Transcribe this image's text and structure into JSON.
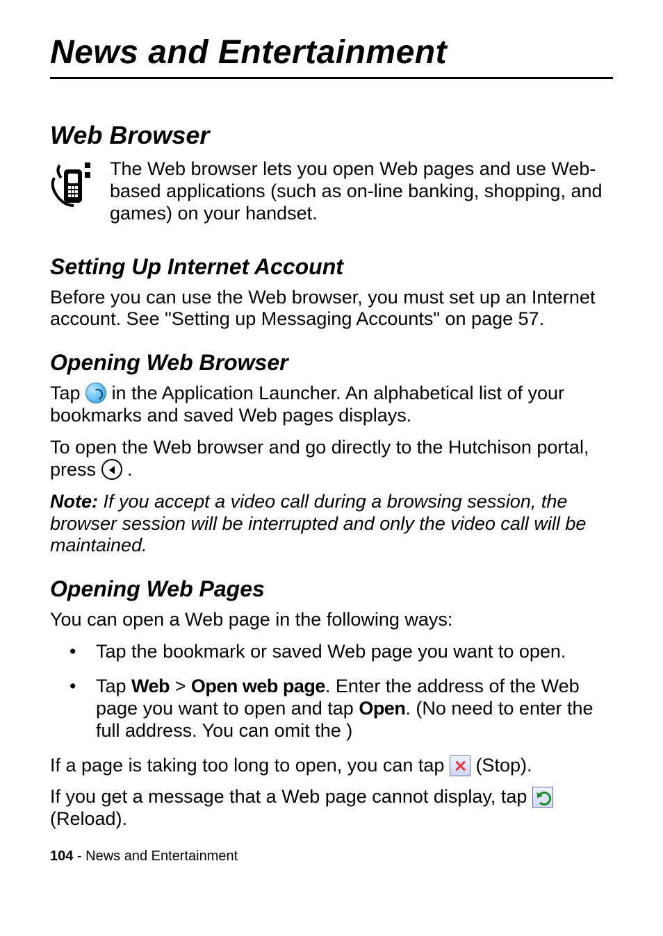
{
  "chapter_title": "News and Entertainment",
  "section_web_browser": {
    "heading": "Web Browser",
    "intro": "The Web browser lets you open Web pages and use Web-based applications (such as on-line banking, shopping, and games) on your handset."
  },
  "section_setup": {
    "heading": "Setting Up Internet Account",
    "body": "Before you can use the Web browser, you must set up an Internet account. See \"Setting up Messaging Accounts\" on page 57."
  },
  "section_open_browser": {
    "heading": "Opening Web Browser",
    "p1_pre": "Tap ",
    "p1_post": " in the Application Launcher. An alphabetical list of your bookmarks and saved Web pages displays.",
    "p2_pre": "To open the Web browser and go directly to the Hutchison portal, press ",
    "p2_post": ".",
    "note_label": "Note: ",
    "note_body": "If you accept a video call during a browsing session, the browser session will be interrupted and only the video call will be maintained."
  },
  "section_open_pages": {
    "heading": "Opening Web Pages",
    "intro": "You can open a Web page in the following ways:",
    "bullet1": "Tap the bookmark or saved Web page you want to open.",
    "bullet2": {
      "pre": "Tap ",
      "web": "Web",
      "sep": " > ",
      "open_web_page": "Open web page",
      "mid1": ". Enter the address of the Web page you want to open and tap ",
      "open": "Open",
      "mid2": ". (No need to enter the full address. You can omit the ",
      "post": ")"
    },
    "p_stop_pre": "If a page is taking too long to open, you can tap ",
    "p_stop_post": " (Stop).",
    "p_reload_pre": "If you get a message that a Web page cannot display, tap ",
    "p_reload_post": " (Reload)."
  },
  "footer": {
    "page_number": "104",
    "sep": " - ",
    "chapter": "News and Entertainment"
  }
}
